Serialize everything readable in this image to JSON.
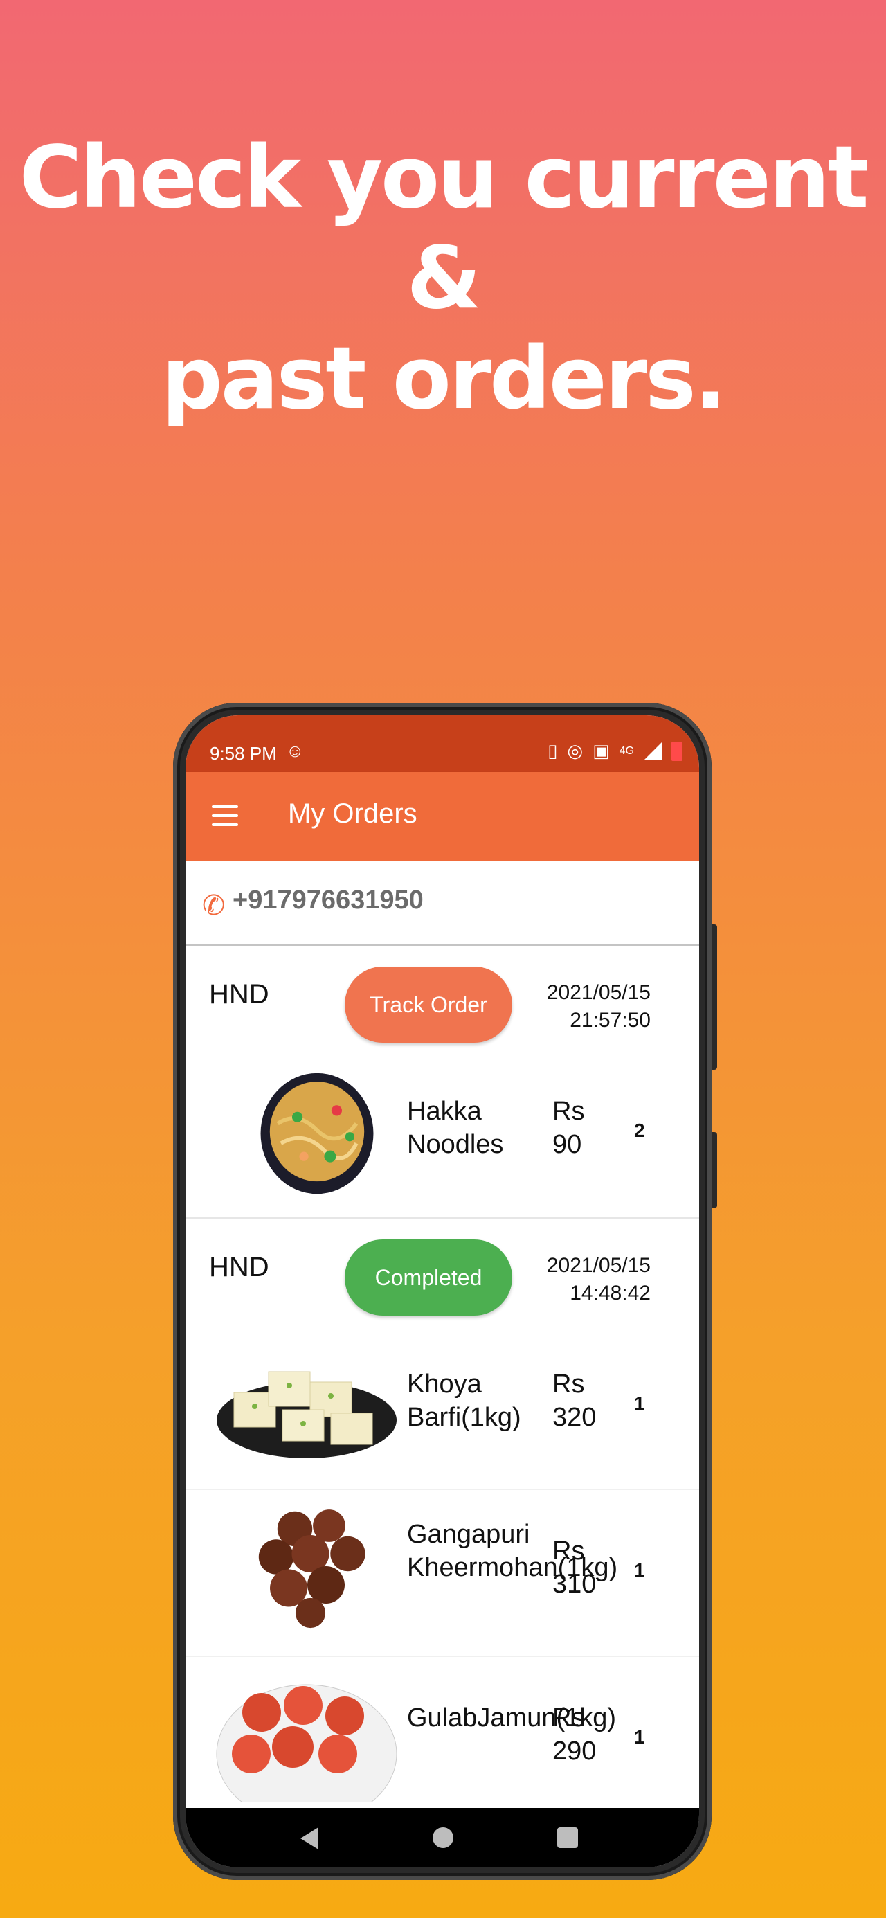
{
  "headline": {
    "line1": "Check you current",
    "line2": "&",
    "line3": "past orders."
  },
  "status_bar": {
    "time": "9:58 PM",
    "network": "4G"
  },
  "app_bar": {
    "title": "My Orders",
    "menu_icon": "hamburger-menu-icon"
  },
  "account": {
    "phone_icon": "phone-icon",
    "phone_number": "+917976631950"
  },
  "orders": [
    {
      "store": "HND",
      "status_label": "Track Order",
      "status_color": "#f0744f",
      "date": "2021/05/15",
      "time": "21:57:50",
      "items": [
        {
          "name": "Hakka Noodles",
          "price_label": "Rs",
          "price": "90",
          "qty": "2"
        }
      ]
    },
    {
      "store": "HND",
      "status_label": "Completed",
      "status_color": "#4caf50",
      "date": "2021/05/15",
      "time": "14:48:42",
      "items": [
        {
          "name": "Khoya Barfi(1kg)",
          "price_label": "Rs",
          "price": "320",
          "qty": "1"
        },
        {
          "name": "Gangapuri Kheermohan(1kg)",
          "price_label": "Rs",
          "price": "310",
          "qty": "1"
        },
        {
          "name": "GulabJamun(1kg)",
          "price_label": "Rs",
          "price": "290",
          "qty": "1"
        }
      ]
    }
  ],
  "colors": {
    "accent": "#f06b3a",
    "status_bar": "#c7401a"
  }
}
